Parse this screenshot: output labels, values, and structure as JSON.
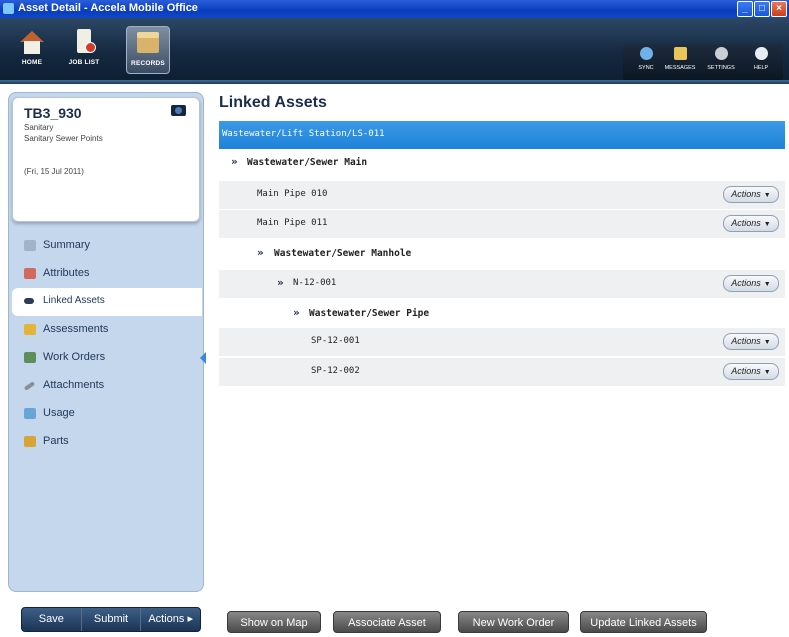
{
  "window": {
    "title": "Asset Detail - Accela Mobile Office"
  },
  "toolbar": {
    "nav": [
      {
        "label": "HOME",
        "icon": "home-icon"
      },
      {
        "label": "JOB LIST",
        "icon": "job-list-icon"
      },
      {
        "label": "RECORDS",
        "icon": "records-icon"
      }
    ],
    "right": [
      {
        "label": "SYNC",
        "icon": "sync-icon"
      },
      {
        "label": "MESSAGES",
        "icon": "messages-icon"
      },
      {
        "label": "SETTINGS",
        "icon": "settings-icon"
      },
      {
        "label": "HELP",
        "icon": "help-icon"
      }
    ]
  },
  "record": {
    "id": "TB3_930",
    "type": "Sanitary",
    "subtype": "Sanitary Sewer Points",
    "date": "(Fri, 15 Jul 2011)"
  },
  "menu": [
    {
      "label": "Summary",
      "icon": "summary-icon"
    },
    {
      "label": "Attributes",
      "icon": "attributes-icon"
    },
    {
      "label": "Linked Assets",
      "icon": "linked-assets-icon",
      "active": true
    },
    {
      "label": "Assessments",
      "icon": "assessments-icon"
    },
    {
      "label": "Work Orders",
      "icon": "work-orders-icon"
    },
    {
      "label": "Attachments",
      "icon": "attachments-icon"
    },
    {
      "label": "Usage",
      "icon": "usage-icon"
    },
    {
      "label": "Parts",
      "icon": "parts-icon"
    }
  ],
  "main": {
    "title": "Linked Assets",
    "selected": "Wastewater/Lift Station/LS-011",
    "rows": [
      {
        "text": "Wastewater/Sewer Main",
        "kind": "header"
      },
      {
        "text": "Main Pipe 010",
        "kind": "item",
        "action": "Actions"
      },
      {
        "text": "Main Pipe 011",
        "kind": "item",
        "action": "Actions"
      },
      {
        "text": "Wastewater/Sewer Manhole",
        "kind": "header"
      },
      {
        "text": "N-12-001",
        "kind": "group",
        "action": "Actions"
      },
      {
        "text": "Wastewater/Sewer Pipe",
        "kind": "header"
      },
      {
        "text": "SP-12-001",
        "kind": "item",
        "action": "Actions"
      },
      {
        "text": "SP-12-002",
        "kind": "item",
        "action": "Actions"
      }
    ]
  },
  "bottom": {
    "left": [
      "Save",
      "Submit",
      "Actions ▸"
    ],
    "right": [
      "Show on Map",
      "Associate Asset",
      "New Work Order",
      "Update Linked Assets"
    ]
  },
  "colors": {
    "accent": "#1f82d8",
    "toolbar": "#14283f",
    "panel": "#c4d7ec"
  }
}
